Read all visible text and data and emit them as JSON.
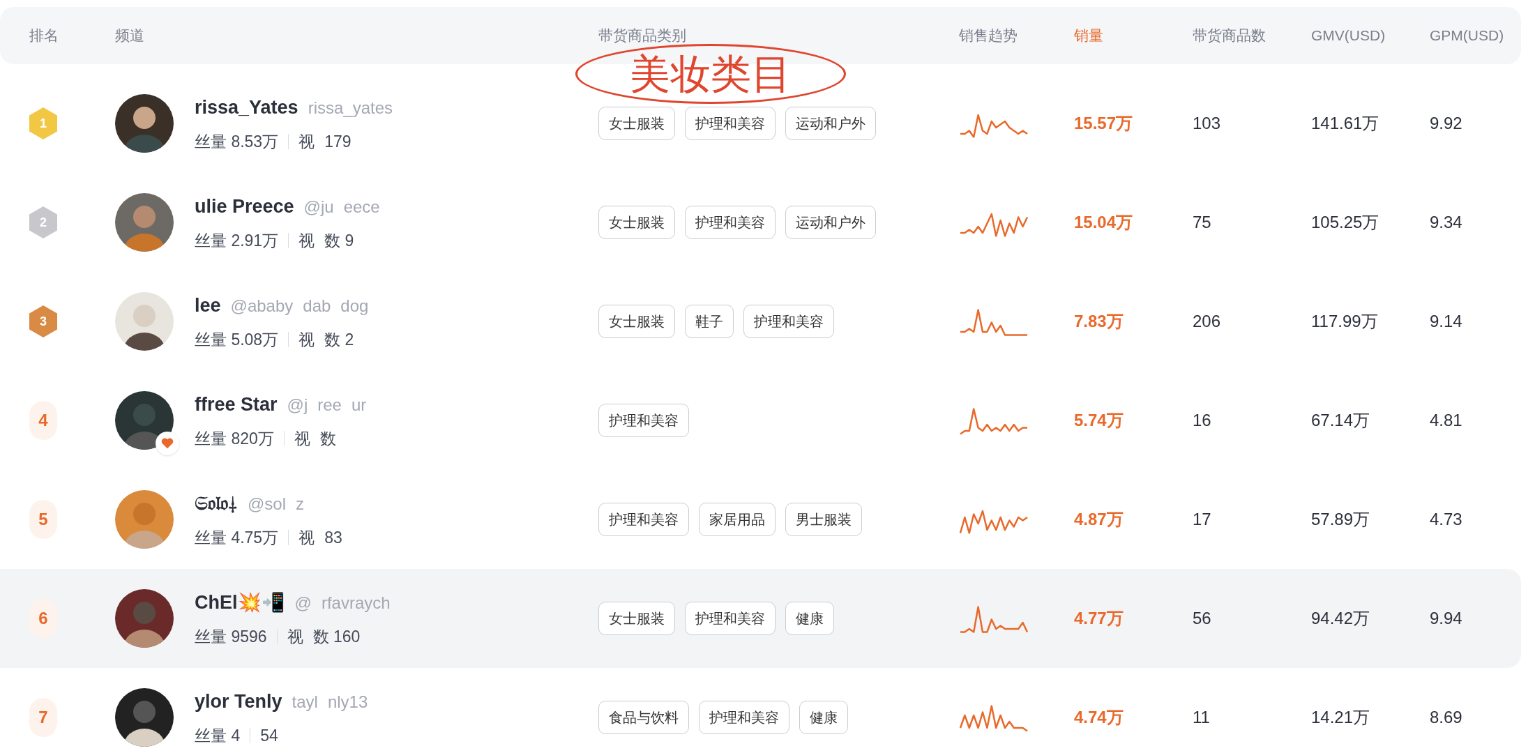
{
  "header": {
    "columns": [
      {
        "label": "排名",
        "accent": false
      },
      {
        "label": "频道",
        "accent": false
      },
      {
        "label": "带货商品类别",
        "accent": false
      },
      {
        "label": "销售趋势",
        "accent": false
      },
      {
        "label": "销量",
        "accent": true
      },
      {
        "label": "带货商品数",
        "accent": false
      },
      {
        "label": "GMV(USD)",
        "accent": false
      },
      {
        "label": "GPM(USD)",
        "accent": false
      }
    ]
  },
  "annotation": {
    "text": "美妆类目"
  },
  "rows": [
    {
      "rank": {
        "kind": "medal",
        "text": "1",
        "color": "#f2c744"
      },
      "highlighted": false,
      "heart": false,
      "name": "rissa_Yates",
      "handle": [
        "rissa_yates"
      ],
      "fans": "丝量 8.53万",
      "videos": [
        "视",
        "179"
      ],
      "categories": [
        "女士服装",
        "护理和美容",
        "运动和户外"
      ],
      "sales": "15.57万",
      "products": "103",
      "gmv": "141.61万",
      "gpm": "9.92"
    },
    {
      "rank": {
        "kind": "medal",
        "text": "2",
        "color": "#c8c8cc"
      },
      "highlighted": false,
      "heart": false,
      "name": "ulie Preece",
      "handle": [
        "@ju",
        "eece"
      ],
      "fans": "丝量 2.91万",
      "videos": [
        "视",
        "数 9"
      ],
      "categories": [
        "女士服装",
        "护理和美容",
        "运动和户外"
      ],
      "sales": "15.04万",
      "products": "75",
      "gmv": "105.25万",
      "gpm": "9.34"
    },
    {
      "rank": {
        "kind": "medal",
        "text": "3",
        "color": "#d98a45"
      },
      "highlighted": false,
      "heart": false,
      "name": "lee",
      "handle": [
        "@ababy",
        "dab",
        "dog"
      ],
      "fans": "丝量 5.08万",
      "videos": [
        "视",
        "数 2"
      ],
      "categories": [
        "女士服装",
        "鞋子",
        "护理和美容"
      ],
      "sales": "7.83万",
      "products": "206",
      "gmv": "117.99万",
      "gpm": "9.14"
    },
    {
      "rank": {
        "kind": "number",
        "text": "4"
      },
      "highlighted": false,
      "heart": true,
      "name": "ffree Star",
      "handle": [
        "@j",
        "ree",
        "ur"
      ],
      "fans": "丝量 820万",
      "videos": [
        "视",
        "数"
      ],
      "categories": [
        "护理和美容"
      ],
      "sales": "5.74万",
      "products": "16",
      "gmv": "67.14万",
      "gpm": "4.81"
    },
    {
      "rank": {
        "kind": "number",
        "text": "5"
      },
      "highlighted": false,
      "heart": false,
      "name": "𝔖𝔬𝔩𝔬⸸",
      "handle": [
        "@sol",
        "z"
      ],
      "fans": "丝量 4.75万",
      "videos": [
        "视",
        "83"
      ],
      "categories": [
        "护理和美容",
        "家居用品",
        "男士服装"
      ],
      "sales": "4.87万",
      "products": "17",
      "gmv": "57.89万",
      "gpm": "4.73"
    },
    {
      "rank": {
        "kind": "number",
        "text": "6"
      },
      "highlighted": true,
      "heart": false,
      "name": "ChEl💥📲",
      "handle": [
        "@",
        "rfavraych"
      ],
      "fans": "丝量 9596",
      "videos": [
        "视",
        "数 160"
      ],
      "categories": [
        "女士服装",
        "护理和美容",
        "健康"
      ],
      "sales": "4.77万",
      "products": "56",
      "gmv": "94.42万",
      "gpm": "9.94"
    },
    {
      "rank": {
        "kind": "number",
        "text": "7"
      },
      "highlighted": false,
      "heart": false,
      "name": "ylor Tenly",
      "handle": [
        "tayl",
        "nly13"
      ],
      "fans": "丝量 4",
      "videos": [
        "54"
      ],
      "categories": [
        "食品与饮料",
        "护理和美容",
        "健康"
      ],
      "sales": "4.74万",
      "products": "11",
      "gmv": "14.21万",
      "gpm": "8.69"
    }
  ]
}
